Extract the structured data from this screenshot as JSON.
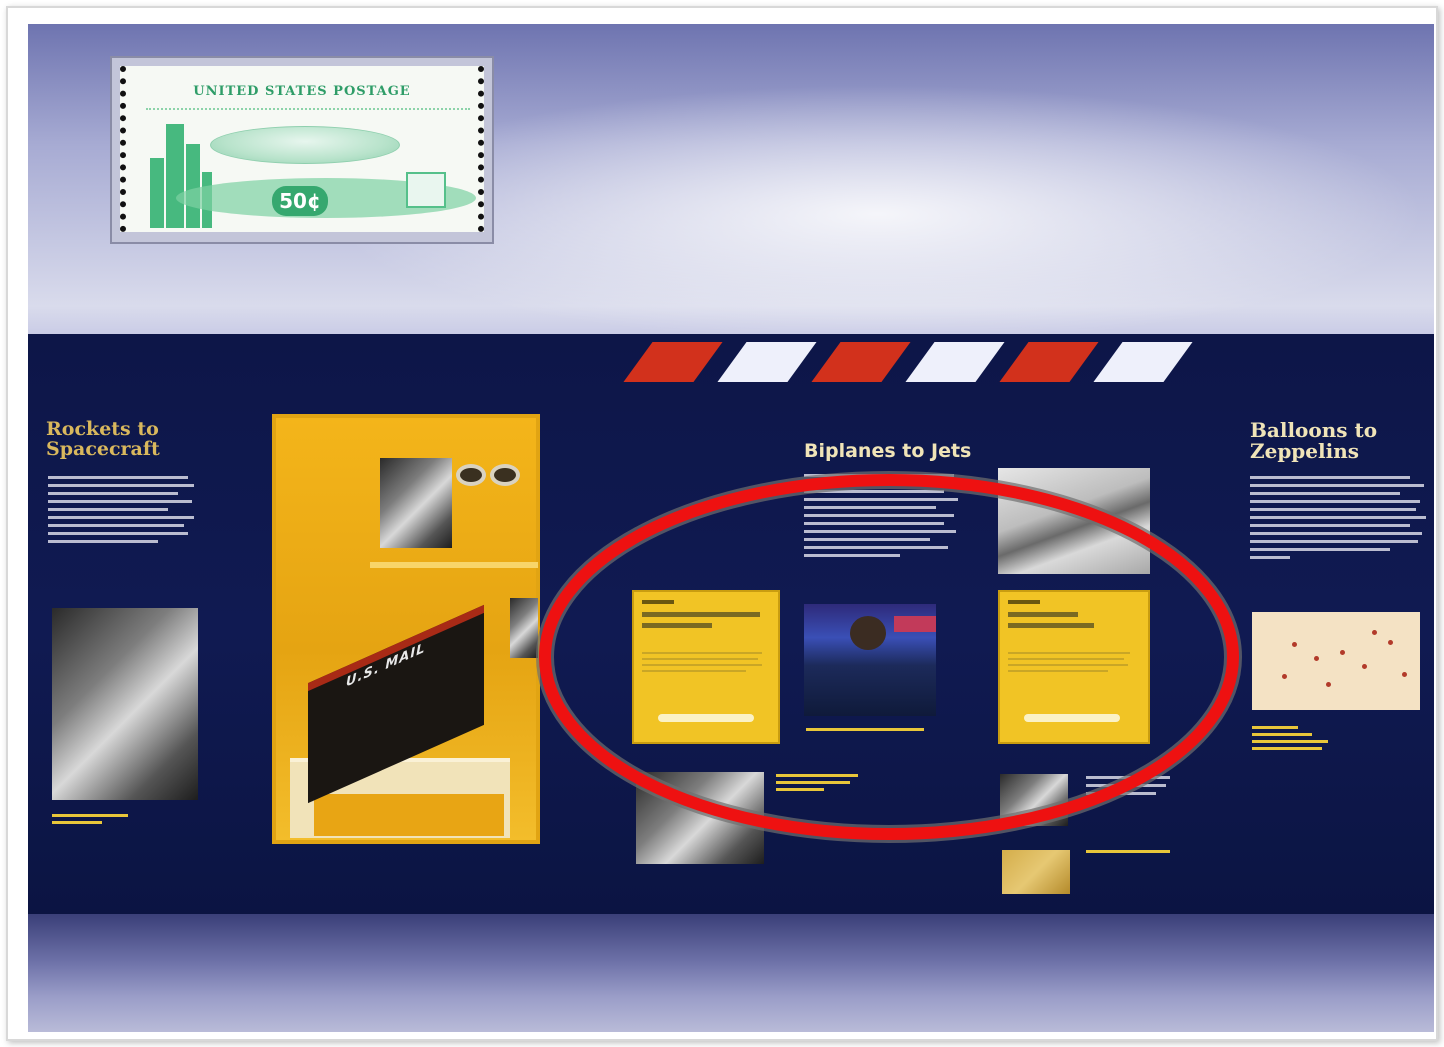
{
  "stamp": {
    "title": "UNITED STATES POSTAGE",
    "value": "50¢"
  },
  "mailbox": {
    "label": "U.S. MAIL"
  },
  "panels": [
    {
      "id": "left",
      "title_line1": "Rockets to",
      "title_line2": "Spacecraft"
    },
    {
      "id": "mid",
      "title_line1": "Biplanes to Jets",
      "title_line2": ""
    },
    {
      "id": "right",
      "title_line1": "Balloons to",
      "title_line2": "Zeppelins"
    }
  ],
  "colors": {
    "wall": "#101a52",
    "case_yellow": "#f4b51a",
    "card_yellow": "#f1c425",
    "stripe_red": "#d2311c",
    "stripe_white": "#eef0fb",
    "highlight_ellipse": "#ee1111",
    "title_gold": "#f0e4b8"
  },
  "stripes": [
    "red",
    "white",
    "red",
    "white",
    "red",
    "white"
  ],
  "highlight": {
    "shape": "ellipse",
    "color": "red"
  }
}
